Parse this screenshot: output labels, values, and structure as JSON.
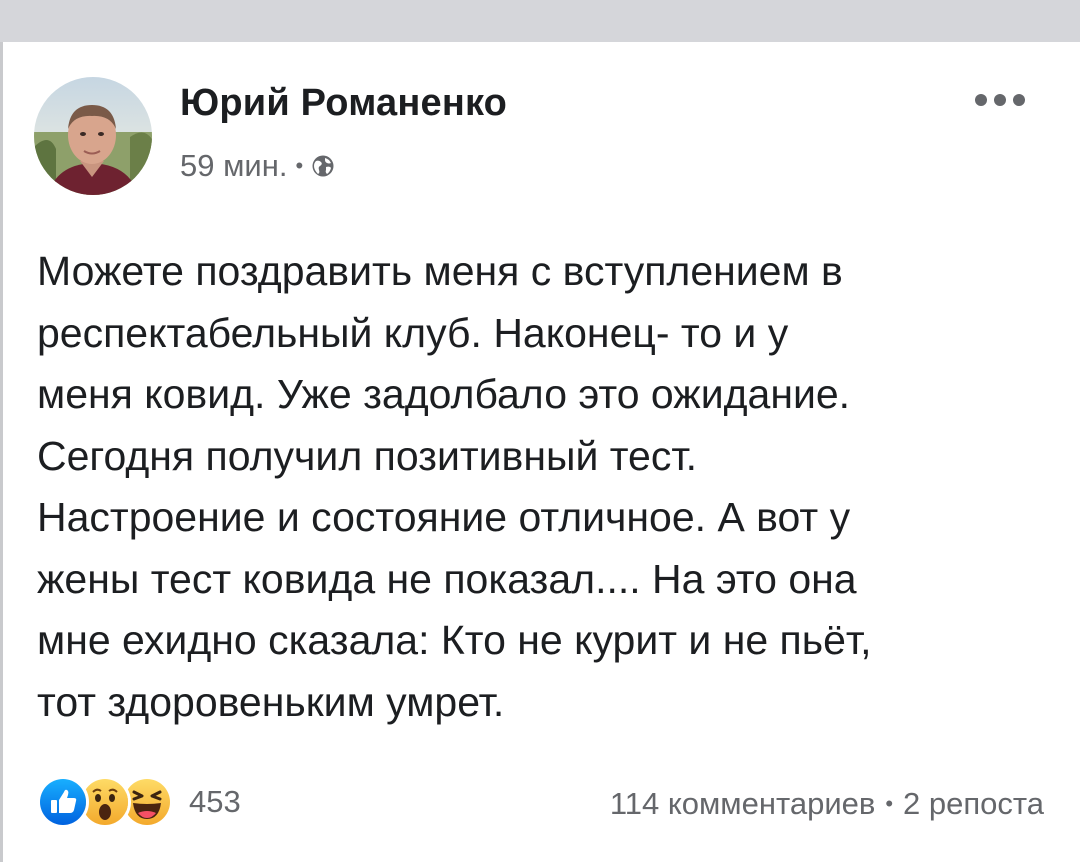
{
  "post": {
    "author": "Юрий Романенко",
    "time": "59 мин.",
    "separator": "•",
    "privacy_icon": "globe-icon",
    "menu_icon": "more-options-icon",
    "text_lines": [
      "Можете поздравить меня с вступлением в",
      "респектабельный клуб. Наконец- то и у",
      "меня ковид. Уже задолбало это ожидание.",
      "Сегодня получил позитивный тест.",
      "Настроение и состояние отличное. А вот у",
      "жены тест ковида не показал.... На это она",
      "мне ехидно сказала: Кто не курит и не пьёт,",
      "тот здоровеньким умрет."
    ]
  },
  "footer": {
    "reaction_icons": [
      "like-icon",
      "wow-icon",
      "haha-icon"
    ],
    "reaction_count": "453",
    "comments": "114 комментариев",
    "separator": "•",
    "shares": "2 репоста"
  },
  "colors": {
    "text": "#1c1e21",
    "secondary_text": "#65676b",
    "like_blue": "#1877f2",
    "emoji_yellow": "#f7b928",
    "top_bar": "#d5d6da"
  }
}
